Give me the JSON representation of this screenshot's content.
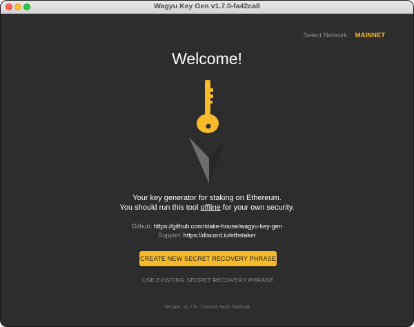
{
  "window": {
    "title": "Wagyu Key Gen v1.7.0-fa42ca8"
  },
  "network": {
    "label": "Select Network:",
    "value": "MAINNET"
  },
  "main": {
    "heading": "Welcome!",
    "tagline_line1": "Your key generator for staking on Ethereum.",
    "tagline_line2_pre": "You should run this tool ",
    "tagline_line2_emph": "offline",
    "tagline_line2_post": " for your own security.",
    "github_label": "Github:",
    "github_url": "https://github.com/stake-house/wagyu-key-gen",
    "support_label": "Support:",
    "support_url": "https://discord.io/ethstaker"
  },
  "actions": {
    "create_label": "CREATE NEW SECRET RECOVERY PHRASE",
    "existing_label": "USE EXISTING SECRET RECOVERY PHRASE"
  },
  "footer": {
    "version_text": "Version: v1.7.0 - Commit Hash: fa42ca8"
  },
  "colors": {
    "background": "#2d2d2d",
    "accent": "#f6ba2a",
    "text": "#ffffff",
    "muted": "#8f8f8f"
  },
  "icons": {
    "logo": "key-logo-icon"
  }
}
